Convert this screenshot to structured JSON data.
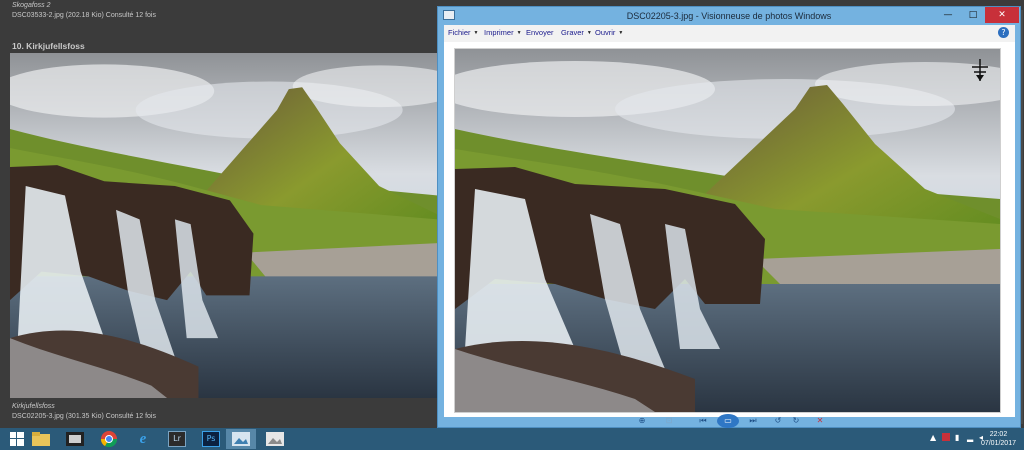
{
  "gallery": {
    "prev_caption_title": "Skogafoss 2",
    "prev_caption_info": "DSC03533-2.jpg (202.18 Kio) Consulté 12 fois",
    "section_title": "10. Kirkjufellsfoss",
    "caption_title": "Kirkjufellsfoss",
    "caption_info": "DSC02205-3.jpg (301.35 Kio) Consulté 12 fois"
  },
  "viewer": {
    "title": "DSC02205-3.jpg - Visionneuse de photos Windows",
    "menu": [
      "Fichier",
      "Imprimer",
      "Envoyer",
      "Graver",
      "Ouvrir"
    ],
    "help": "?",
    "minimize": "—",
    "maximize": "□",
    "close": "✕"
  },
  "taskbar": {
    "time": "22:02",
    "date": "07/01/2017",
    "apps": [
      "windows-start",
      "file-explorer",
      "media-player",
      "chrome",
      "internet-explorer",
      "Lr",
      "Ps",
      "photo-viewer",
      "photo-viewer-2"
    ]
  },
  "colors": {
    "taskbar": "#2b5a79",
    "window_frame": "#74b2e0",
    "close_button": "#c8303a",
    "gallery_bg": "#3b3b3b"
  }
}
